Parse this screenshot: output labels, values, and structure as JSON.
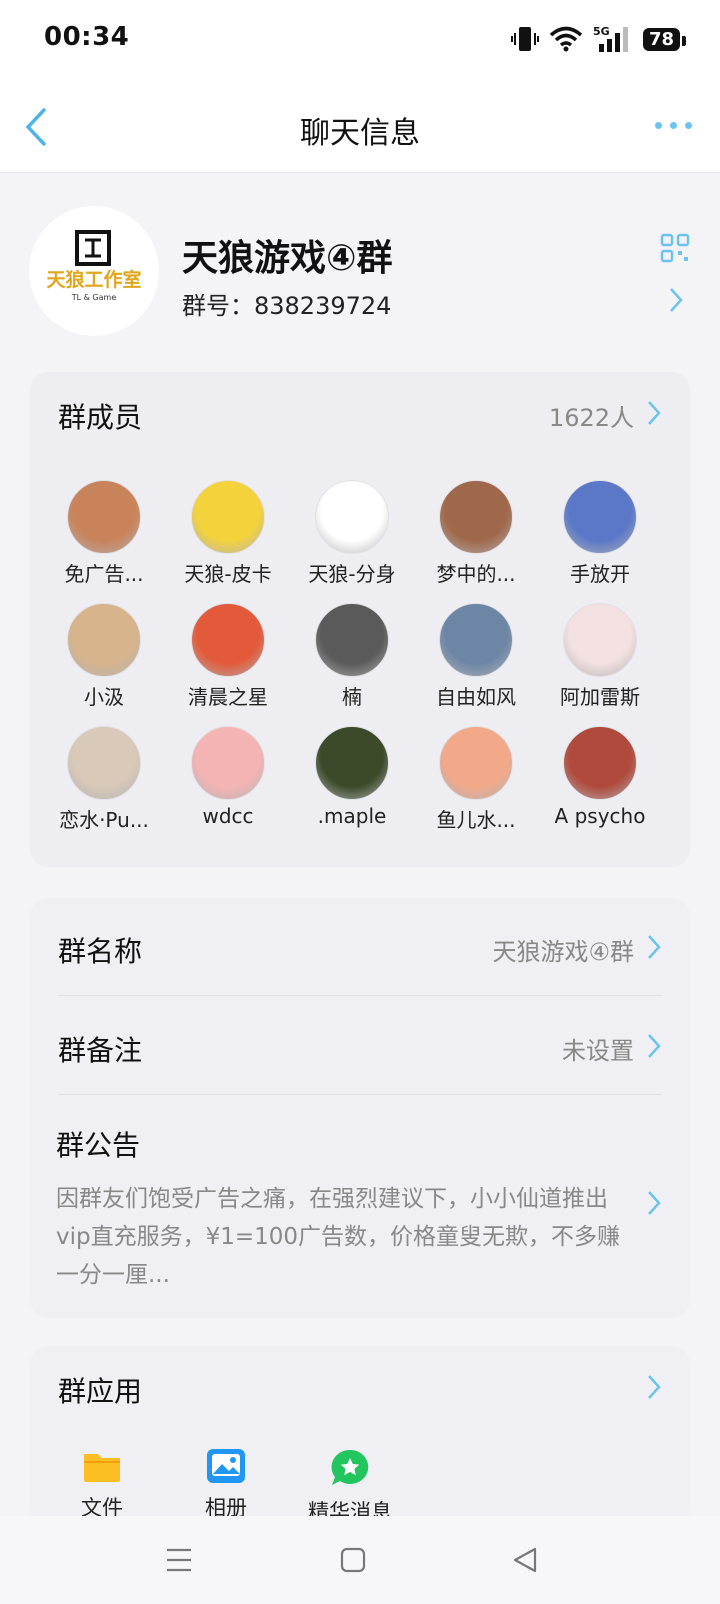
{
  "status_bar": {
    "time": "00:34",
    "network": "5G",
    "battery": "78"
  },
  "nav": {
    "title": "聊天信息"
  },
  "group": {
    "name": "天狼游戏④群",
    "id_label": "群号：",
    "id": "838239724",
    "logo_text": "天狼工作室",
    "logo_sub": "TL & Game"
  },
  "members": {
    "title": "群成员",
    "count": "1622人",
    "items": [
      {
        "name": "免广告...",
        "color": "#c9835a"
      },
      {
        "name": "天狼-皮卡",
        "color": "#f4d23c"
      },
      {
        "name": "天狼-分身",
        "color": "#ffffff"
      },
      {
        "name": "梦中的...",
        "color": "#a0684a"
      },
      {
        "name": "手放开",
        "color": "#5b78c8"
      },
      {
        "name": "小汲",
        "color": "#d7b48c"
      },
      {
        "name": "清晨之星",
        "color": "#e25a3a"
      },
      {
        "name": "楠",
        "color": "#5a5a5a"
      },
      {
        "name": "自由如风",
        "color": "#6d86a6"
      },
      {
        "name": "阿加雷斯",
        "color": "#f3e0e0"
      },
      {
        "name": "恋水·Pu...",
        "color": "#d8c9b8"
      },
      {
        "name": "wdcc",
        "color": "#f5b4b4"
      },
      {
        "name": ".maple",
        "color": "#3c4a2a"
      },
      {
        "name": "鱼儿水...",
        "color": "#f2a98a"
      },
      {
        "name": "A psycho",
        "color": "#b04a3c"
      }
    ]
  },
  "info": {
    "group_name_label": "群名称",
    "group_name_value": "天狼游戏④群",
    "remark_label": "群备注",
    "remark_value": "未设置",
    "notice_label": "群公告",
    "notice_text": "因群友们饱受广告之痛，在强烈建议下，小小仙道推出vip直充服务，¥1=100广告数，价格童叟无欺，不多赚一分一厘..."
  },
  "apps": {
    "title": "群应用",
    "items": [
      {
        "label": "文件",
        "icon": "folder-icon",
        "color": "#fbbf24"
      },
      {
        "label": "相册",
        "icon": "photo-album-icon",
        "color": "#2196f3"
      },
      {
        "label": "精华消息",
        "icon": "star-message-icon",
        "color": "#22c55e"
      }
    ]
  },
  "colors": {
    "accent": "#4fb3ea",
    "background": "#f4f4f7",
    "muted_text": "#888888"
  }
}
